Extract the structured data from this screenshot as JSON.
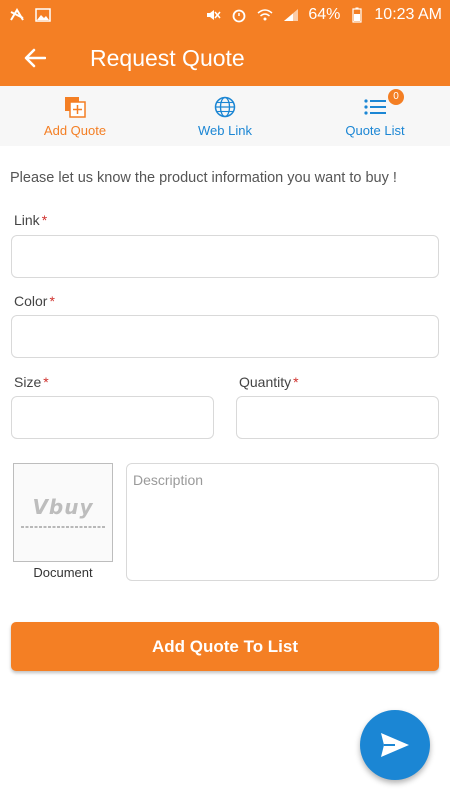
{
  "status_bar": {
    "battery": "64%",
    "time": "10:23 AM"
  },
  "app_bar": {
    "title": "Request Quote"
  },
  "tabs": [
    {
      "label": "Add Quote",
      "icon": "add-quote-icon",
      "active": true
    },
    {
      "label": "Web Link",
      "icon": "globe-icon"
    },
    {
      "label": "Quote List",
      "icon": "list-icon",
      "badge": "0"
    }
  ],
  "form": {
    "intro": "Please let us know the product information you want to buy !",
    "link_label": "Link",
    "color_label": "Color",
    "size_label": "Size",
    "quantity_label": "Quantity",
    "required_mark": "*",
    "link_value": "",
    "color_value": "",
    "size_value": "",
    "quantity_value": "",
    "description_placeholder": "Description",
    "document_label": "Document",
    "logo_text": "Vbuy"
  },
  "actions": {
    "submit_label": "Add Quote To List"
  },
  "colors": {
    "primary": "#f47f24",
    "accent": "#1b86d4",
    "required": "#d0312d"
  }
}
